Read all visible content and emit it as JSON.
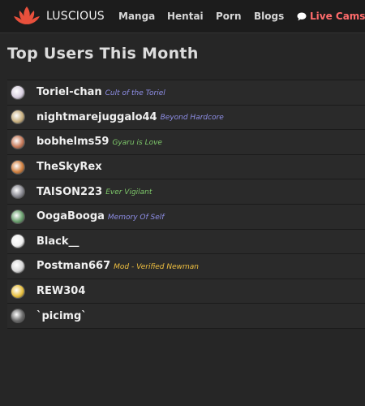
{
  "nav": {
    "logo_text": "LUSCIOUS",
    "links": [
      "Manga",
      "Hentai",
      "Porn",
      "Blogs"
    ],
    "live_cams": "Live Cams",
    "live_icon": "chat-bubble-icon",
    "accent_color": "#ff6b6b"
  },
  "page": {
    "title": "Top Users This Month"
  },
  "users": [
    {
      "name": "Toriel-chan",
      "title": "Cult of the Toriel",
      "title_color": "#8f8fe8",
      "avatar_color": "#d9d0e0"
    },
    {
      "name": "nightmarejuggalo44",
      "title": "Beyond Hardcore",
      "title_color": "#8f8fe8",
      "avatar_color": "#c8b080"
    },
    {
      "name": "bobhelms59",
      "title": "Gyaru is Love",
      "title_color": "#7ec86a",
      "avatar_color": "#c77a5a"
    },
    {
      "name": "TheSkyRex",
      "title": "",
      "title_color": "#8f8fe8",
      "avatar_color": "#d08040"
    },
    {
      "name": "TAISON223",
      "title": "Ever Vigilant",
      "title_color": "#7ec86a",
      "avatar_color": "#8a8a92"
    },
    {
      "name": "OogaBooga",
      "title": "Memory Of Self",
      "title_color": "#8f8fe8",
      "avatar_color": "#6aa06e"
    },
    {
      "name": "Black__",
      "title": "",
      "title_color": "#8f8fe8",
      "avatar_color": "#f0f0f0"
    },
    {
      "name": "Postman667",
      "title": "Mod - Verified Newman",
      "title_color": "#f0c040",
      "avatar_color": "#d8d8d8"
    },
    {
      "name": "REW304",
      "title": "",
      "title_color": "#8f8fe8",
      "avatar_color": "#e8c040"
    },
    {
      "name": "`picimg`",
      "title": "",
      "title_color": "#8f8fe8",
      "avatar_color": "#707070"
    }
  ]
}
